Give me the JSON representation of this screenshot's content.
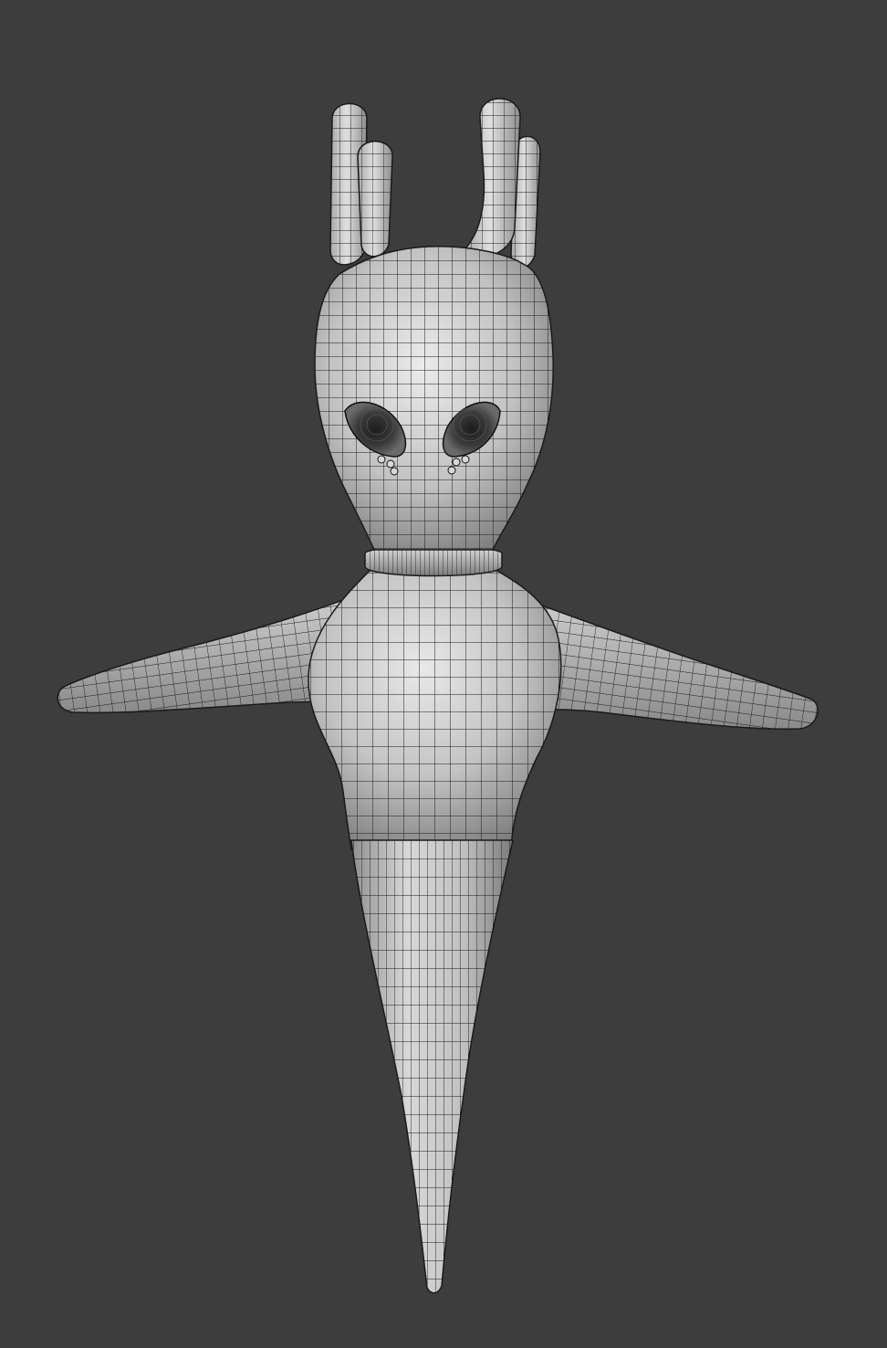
{
  "viewport": {
    "background_color": "#3d3d3d",
    "shading": "solid",
    "overlay": "wireframe"
  },
  "model": {
    "surface_color": "#c8c8c8",
    "highlight_color": "#e6e6e6",
    "shadow_color": "#7a7a7a",
    "wire_color": "#1a1a1a",
    "parts": [
      "antler-left-outer",
      "antler-left-inner",
      "antler-right-outer",
      "antler-right-inner",
      "head",
      "eye-left",
      "eye-right",
      "collar-ring",
      "torso",
      "arm-left",
      "arm-right",
      "tail-spike"
    ]
  }
}
